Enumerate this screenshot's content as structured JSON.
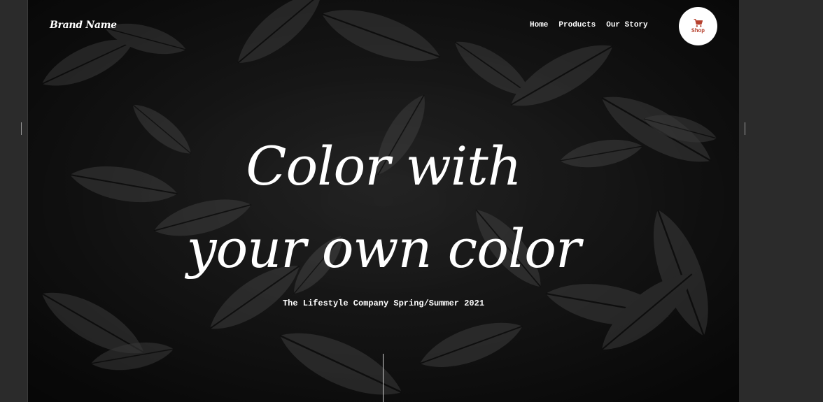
{
  "nav": {
    "brand": "Brand Name",
    "links": [
      "Home",
      "Products",
      "Our Story"
    ],
    "cart": {
      "label": "Shop",
      "icon": "cart-icon"
    }
  },
  "hero": {
    "headline_line1": "Color with",
    "headline_line2": "your own color",
    "subtitle": "The Lifestyle Company Spring/Summer 2021"
  },
  "colors": {
    "accent": "#b6412e",
    "text": "#ffffff",
    "page_background": "#2b2b2b"
  }
}
